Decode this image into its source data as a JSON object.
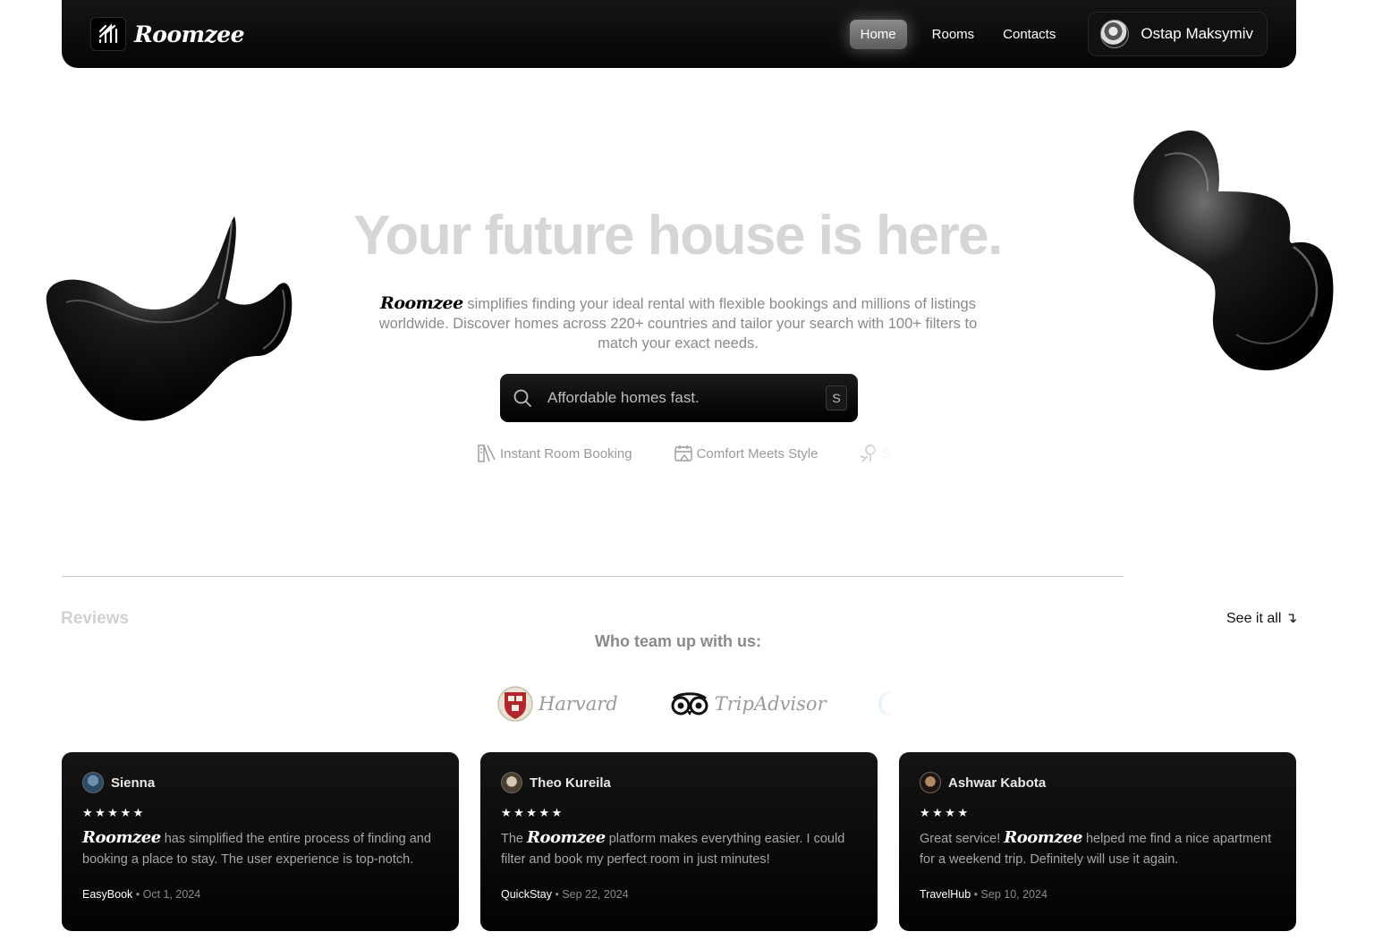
{
  "brand": {
    "name": "Roomzee"
  },
  "nav": {
    "items": [
      {
        "label": "Home",
        "active": true
      },
      {
        "label": "Rooms",
        "active": false
      },
      {
        "label": "Contacts",
        "active": false
      }
    ],
    "user": {
      "name": "Ostap Maksymiv"
    }
  },
  "hero": {
    "title": "Your future house is here.",
    "description_brand": "Roomzee",
    "description": "simplifies finding your ideal rental with flexible bookings and millions of listings worldwide. Discover homes across 220+ countries and tailor your search with 100+ filters to match your exact needs.",
    "search": {
      "placeholder": "Affordable homes fast.",
      "shortcut": "S"
    },
    "features": [
      {
        "icon": "booking-icon",
        "label": "Instant Room Booking"
      },
      {
        "icon": "calendar-icon",
        "label": "Comfort Meets Style"
      },
      {
        "icon": "pin-icon",
        "label": "S"
      }
    ]
  },
  "reviews": {
    "heading": "Reviews",
    "see_all": "See it all ↴",
    "partners_title": "Who team up with us:",
    "partners": [
      {
        "name": "Harvard",
        "icon": "harvard-shield-icon"
      },
      {
        "name": "TripAdvisor",
        "icon": "tripadvisor-owl-icon"
      }
    ],
    "cards": [
      {
        "name": "Sienna",
        "stars": "★★★★★",
        "prefix": "",
        "brand": "Roomzee",
        "text": "has simplified the entire process of finding and booking a place to stay. The user experience is top-notch.",
        "source": "EasyBook",
        "date": "Oct 1, 2024"
      },
      {
        "name": "Theo Kureila",
        "stars": "★★★★★",
        "prefix": "The",
        "brand": "Roomzee",
        "text": "platform makes everything easier. I could filter and book my perfect room in just minutes!",
        "source": "QuickStay",
        "date": "Sep 22, 2024"
      },
      {
        "name": "Ashwar Kabota",
        "stars": "★★★★",
        "prefix": "Great service!",
        "brand": "Roomzee",
        "text": "helped me find a nice apartment for a weekend trip. Definitely will use it again.",
        "source": "TravelHub",
        "date": "Sep 10, 2024"
      }
    ]
  }
}
